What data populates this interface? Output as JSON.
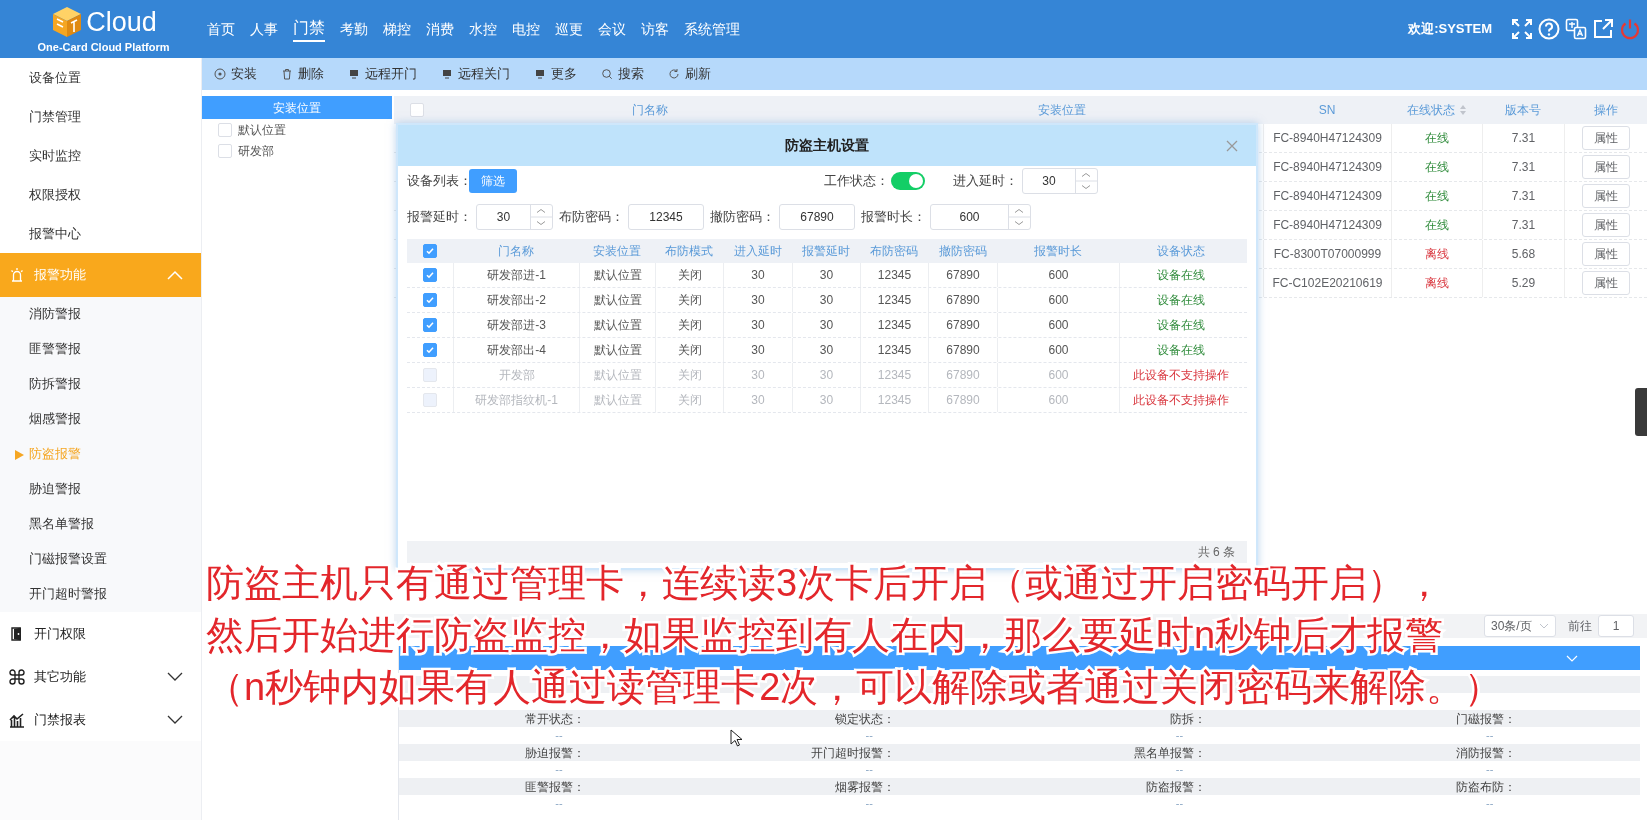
{
  "header": {
    "logo_title": "Cloud",
    "logo_subtitle": "One-Card Cloud Platform",
    "welcome": "欢迎:SYSTEM",
    "nav": [
      {
        "label": "首页",
        "selected": false
      },
      {
        "label": "人事",
        "selected": false
      },
      {
        "label": "门禁",
        "selected": true
      },
      {
        "label": "考勤",
        "selected": false
      },
      {
        "label": "梯控",
        "selected": false
      },
      {
        "label": "消费",
        "selected": false
      },
      {
        "label": "水控",
        "selected": false
      },
      {
        "label": "电控",
        "selected": false
      },
      {
        "label": "巡更",
        "selected": false
      },
      {
        "label": "会议",
        "selected": false
      },
      {
        "label": "访客",
        "selected": false
      },
      {
        "label": "系统管理",
        "selected": false
      }
    ]
  },
  "sidebar": {
    "items": [
      {
        "kind": "link",
        "label": "设备位置",
        "selected": false
      },
      {
        "kind": "link",
        "label": "门禁管理",
        "selected": false
      },
      {
        "kind": "link",
        "label": "实时监控",
        "selected": false
      },
      {
        "kind": "link",
        "label": "权限授权",
        "selected": false
      },
      {
        "kind": "link",
        "label": "报警中心",
        "selected": false
      },
      {
        "kind": "group",
        "label": "报警功能",
        "selected": true,
        "expanded": true,
        "children": [
          {
            "label": "消防警报",
            "selected": false
          },
          {
            "label": "匪警警报",
            "selected": false
          },
          {
            "label": "防拆警报",
            "selected": false
          },
          {
            "label": "烟感警报",
            "selected": false
          },
          {
            "label": "防盗报警",
            "selected": true
          },
          {
            "label": "胁迫警报",
            "selected": false
          },
          {
            "label": "黑名单警报",
            "selected": false
          },
          {
            "label": "门磁报警设置",
            "selected": false
          },
          {
            "label": "开门超时警报",
            "selected": false
          }
        ]
      },
      {
        "kind": "group",
        "label": "开门权限",
        "selected": false
      },
      {
        "kind": "group",
        "label": "其它功能",
        "selected": false,
        "expanded": false
      },
      {
        "kind": "group",
        "label": "门禁报表",
        "selected": false,
        "expanded": false
      }
    ]
  },
  "toolbar": [
    {
      "label": "安装"
    },
    {
      "label": "删除"
    },
    {
      "label": "远程开门"
    },
    {
      "label": "远程关门"
    },
    {
      "label": "更多"
    },
    {
      "label": "搜索"
    },
    {
      "label": "刷新"
    }
  ],
  "tree": {
    "title": "安装位置",
    "items": [
      {
        "label": "默认位置",
        "checked": false
      },
      {
        "label": "研发部",
        "checked": false
      }
    ]
  },
  "device_table": {
    "all_checked": false,
    "columns": [
      {
        "label": "门名称"
      },
      {
        "label": "安装位置"
      },
      {
        "label": "SN"
      },
      {
        "label": "在线状态",
        "sortable": true
      },
      {
        "label": "版本号"
      },
      {
        "label": "操作"
      }
    ],
    "rows": [
      {
        "sn": "FC-8940H47124309",
        "online": true,
        "status": "在线",
        "version": "7.31",
        "action": "属性"
      },
      {
        "sn": "FC-8940H47124309",
        "online": true,
        "status": "在线",
        "version": "7.31",
        "action": "属性"
      },
      {
        "sn": "FC-8940H47124309",
        "online": true,
        "status": "在线",
        "version": "7.31",
        "action": "属性"
      },
      {
        "sn": "FC-8940H47124309",
        "online": true,
        "status": "在线",
        "version": "7.31",
        "action": "属性"
      },
      {
        "sn": "FC-8300T07000999",
        "online": false,
        "status": "离线",
        "version": "5.68",
        "action": "属性"
      },
      {
        "sn": "FC-C102E20210619",
        "online": false,
        "status": "离线",
        "version": "5.29",
        "action": "属性"
      }
    ]
  },
  "pagination": {
    "page_size": "30条/页",
    "goto_label": "前往",
    "page": "1"
  },
  "status_panel": {
    "rows": [
      [
        {
          "label": "常开状态：",
          "value": "--"
        },
        {
          "label": "锁定状态：",
          "value": "--"
        },
        {
          "label": "防拆：",
          "value": "--"
        },
        {
          "label": "门磁报警：",
          "value": "--"
        }
      ],
      [
        {
          "label": "胁迫报警：",
          "value": "--"
        },
        {
          "label": "开门超时报警：",
          "value": "--"
        },
        {
          "label": "黑名单报警：",
          "value": "--"
        },
        {
          "label": "消防报警：",
          "value": "--"
        }
      ],
      [
        {
          "label": "匪警报警：",
          "value": "--"
        },
        {
          "label": "烟雾报警：",
          "value": "--"
        },
        {
          "label": "防盗报警：",
          "value": "--"
        },
        {
          "label": "防盗布防：",
          "value": "--"
        }
      ]
    ]
  },
  "modal": {
    "title": "防盗主机设置",
    "device_list_label": "设备列表：",
    "filter_button": "筛选",
    "work_state": {
      "label": "工作状态：",
      "on": true
    },
    "fields": [
      {
        "label": "进入延时：",
        "value": "30",
        "kind": "spinner"
      },
      {
        "label": "报警延时：",
        "value": "30",
        "kind": "spinner"
      },
      {
        "label": "布防密码：",
        "value": "12345",
        "kind": "text"
      },
      {
        "label": "撤防密码：",
        "value": "67890",
        "kind": "text"
      },
      {
        "label": "报警时长：",
        "value": "600",
        "kind": "spinner"
      }
    ],
    "table": {
      "all_checked": true,
      "columns": [
        "门名称",
        "安装位置",
        "布防模式",
        "进入延时",
        "报警延时",
        "布防密码",
        "撤防密码",
        "报警时长",
        "设备状态"
      ],
      "rows": [
        {
          "checked": true,
          "disabled": false,
          "supported": true,
          "cells": [
            "研发部进-1",
            "默认位置",
            "关闭",
            "30",
            "30",
            "12345",
            "67890",
            "600",
            "设备在线"
          ]
        },
        {
          "checked": true,
          "disabled": false,
          "supported": true,
          "cells": [
            "研发部出-2",
            "默认位置",
            "关闭",
            "30",
            "30",
            "12345",
            "67890",
            "600",
            "设备在线"
          ]
        },
        {
          "checked": true,
          "disabled": false,
          "supported": true,
          "cells": [
            "研发部进-3",
            "默认位置",
            "关闭",
            "30",
            "30",
            "12345",
            "67890",
            "600",
            "设备在线"
          ]
        },
        {
          "checked": true,
          "disabled": false,
          "supported": true,
          "cells": [
            "研发部出-4",
            "默认位置",
            "关闭",
            "30",
            "30",
            "12345",
            "67890",
            "600",
            "设备在线"
          ]
        },
        {
          "checked": false,
          "disabled": true,
          "supported": false,
          "cells": [
            "开发部",
            "默认位置",
            "关闭",
            "30",
            "30",
            "12345",
            "67890",
            "600",
            "此设备不支持操作"
          ]
        },
        {
          "checked": false,
          "disabled": true,
          "supported": false,
          "cells": [
            "研发部指纹机-1",
            "默认位置",
            "关闭",
            "30",
            "30",
            "12345",
            "67890",
            "600",
            "此设备不支持操作"
          ]
        }
      ]
    },
    "total": "共 6 条"
  },
  "caption": [
    "防盗主机只有通过管理卡，连续读3次卡后开启（或通过开启密码开启），",
    "然后开始进行防盗监控，如果监控到有人在内，那么要延时n秒钟后才报警",
    "（n秒钟内如果有人通过读管理卡2次，可以解除或者通过关闭密码来解除。）"
  ]
}
